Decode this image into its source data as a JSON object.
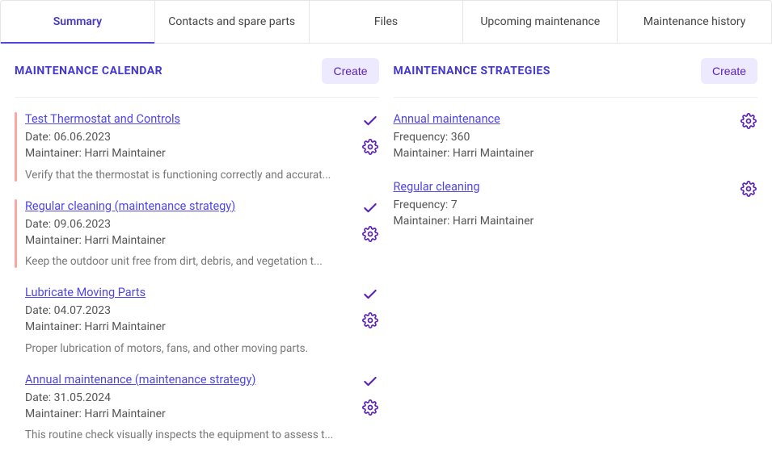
{
  "tabs": [
    {
      "label": "Summary",
      "active": true
    },
    {
      "label": "Contacts and spare parts",
      "active": false
    },
    {
      "label": "Files",
      "active": false
    },
    {
      "label": "Upcoming maintenance",
      "active": false
    },
    {
      "label": "Maintenance history",
      "active": false
    }
  ],
  "calendar": {
    "title": "MAINTENANCE CALENDAR",
    "create_label": "Create",
    "date_label": "Date",
    "maintainer_label": "Maintainer",
    "items": [
      {
        "title": "Test Thermostat and Controls",
        "date": "06.06.2023",
        "maintainer": "Harri Maintainer",
        "desc": "Verify that the thermostat is functioning correctly and accurat...",
        "overdue": true
      },
      {
        "title": "Regular cleaning (maintenance strategy)",
        "date": "09.06.2023",
        "maintainer": "Harri Maintainer",
        "desc": "Keep the outdoor unit free from dirt, debris, and vegetation t...",
        "overdue": true
      },
      {
        "title": "Lubricate Moving Parts",
        "date": "04.07.2023",
        "maintainer": "Harri Maintainer",
        "desc": "Proper lubrication of motors, fans, and other moving parts.",
        "overdue": false
      },
      {
        "title": "Annual maintenance (maintenance strategy)",
        "date": "31.05.2024",
        "maintainer": "Harri Maintainer",
        "desc": "This routine check visually inspects the equipment to assess t...",
        "overdue": false
      }
    ]
  },
  "strategies": {
    "title": "MAINTENANCE STRATEGIES",
    "create_label": "Create",
    "frequency_label": "Frequency",
    "maintainer_label": "Maintainer",
    "items": [
      {
        "title": "Annual maintenance",
        "frequency": "360",
        "maintainer": "Harri Maintainer"
      },
      {
        "title": "Regular cleaning",
        "frequency": "7",
        "maintainer": "Harri Maintainer"
      }
    ]
  }
}
